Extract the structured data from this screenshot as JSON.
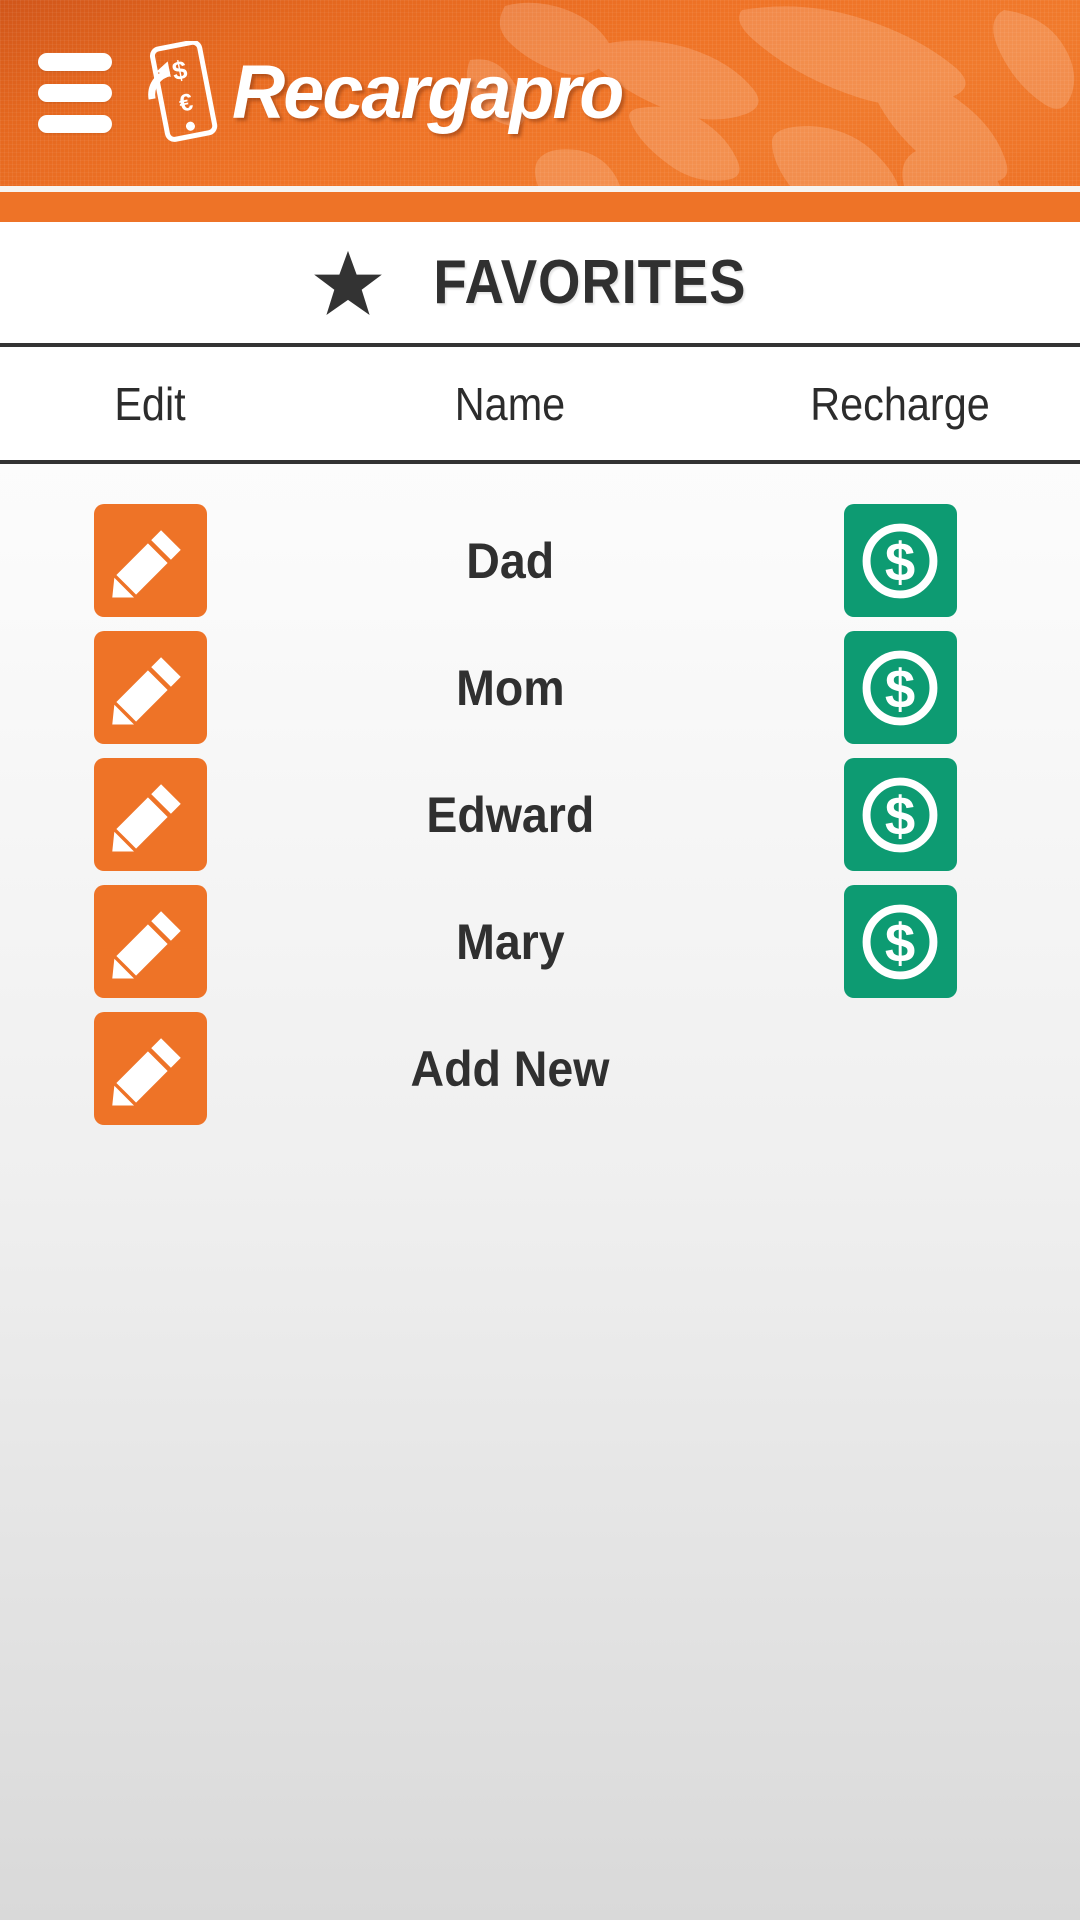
{
  "header": {
    "menu_icon": "hamburger-menu-icon",
    "logo_icon": "recargapro-phone-money-logo",
    "brand": "Recargapro",
    "background_color": "#ee7327",
    "background_decoration": "world-map"
  },
  "page": {
    "star_icon": "star-icon",
    "title": "FAVORITES",
    "title_color": "#303030"
  },
  "table": {
    "columns": [
      {
        "key": "edit",
        "label": "Edit"
      },
      {
        "key": "name",
        "label": "Name"
      },
      {
        "key": "recharge",
        "label": "Recharge"
      }
    ],
    "edit_icon": "pencil-icon",
    "edit_button_color": "#ee7327",
    "recharge_icon": "dollar-circle-icon",
    "recharge_button_color": "#0d9b72",
    "rows": [
      {
        "name": "Dad",
        "has_edit": true,
        "has_recharge": true
      },
      {
        "name": "Mom",
        "has_edit": true,
        "has_recharge": true
      },
      {
        "name": "Edward",
        "has_edit": true,
        "has_recharge": true
      },
      {
        "name": "Mary",
        "has_edit": true,
        "has_recharge": true
      },
      {
        "name": "Add New",
        "has_edit": true,
        "has_recharge": false
      }
    ]
  }
}
